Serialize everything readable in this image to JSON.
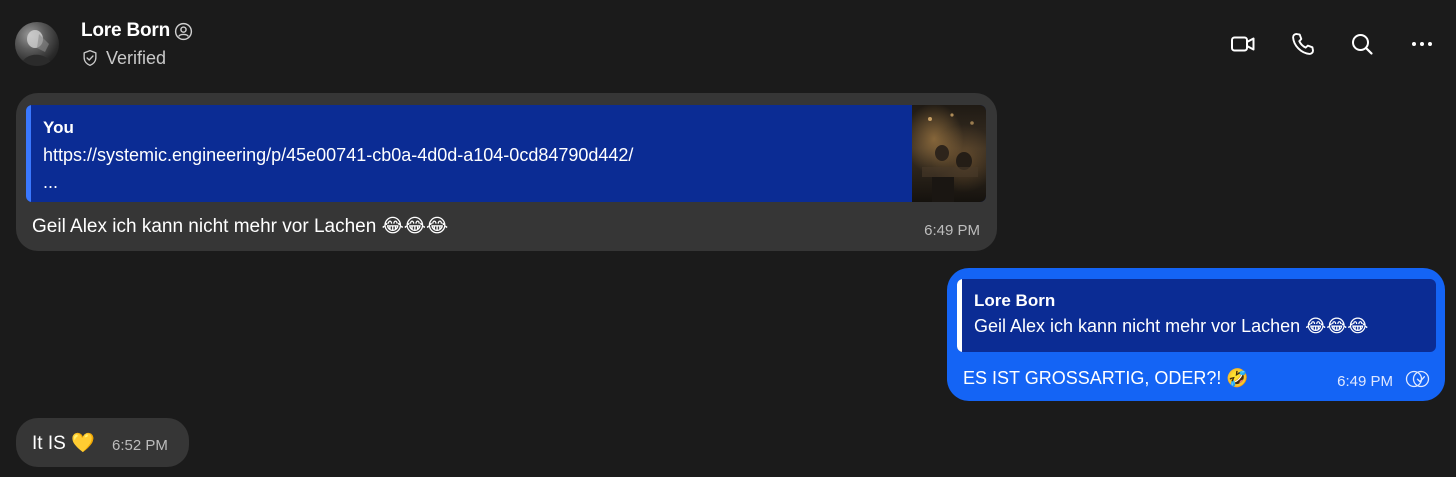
{
  "header": {
    "contact_name": "Lore Born",
    "verified_label": "Verified",
    "actions": [
      "video-call",
      "voice-call",
      "search",
      "more"
    ]
  },
  "messages": [
    {
      "direction": "incoming",
      "quote": {
        "author": "You",
        "text": "https://systemic.engineering/p/45e00741-cb0a-4d0d-a104-0cd84790d442/",
        "more": "..."
      },
      "text": "Geil Alex ich kann nicht mehr vor Lachen 😂😂😂",
      "time": "6:49 PM"
    },
    {
      "direction": "outgoing",
      "quote": {
        "author": "Lore Born",
        "text": "Geil Alex ich kann nicht mehr vor Lachen 😂😂😂"
      },
      "text": "ES IST GROSSARTIG, ODER?! 🤣",
      "time": "6:49 PM",
      "status": "read"
    },
    {
      "direction": "incoming",
      "text": "It IS 💛",
      "time": "6:52 PM"
    }
  ],
  "colors": {
    "background": "#1b1b1b",
    "incoming_bubble": "#363636",
    "outgoing_bubble": "#1464f5",
    "quote_block": "#0b2c94"
  }
}
